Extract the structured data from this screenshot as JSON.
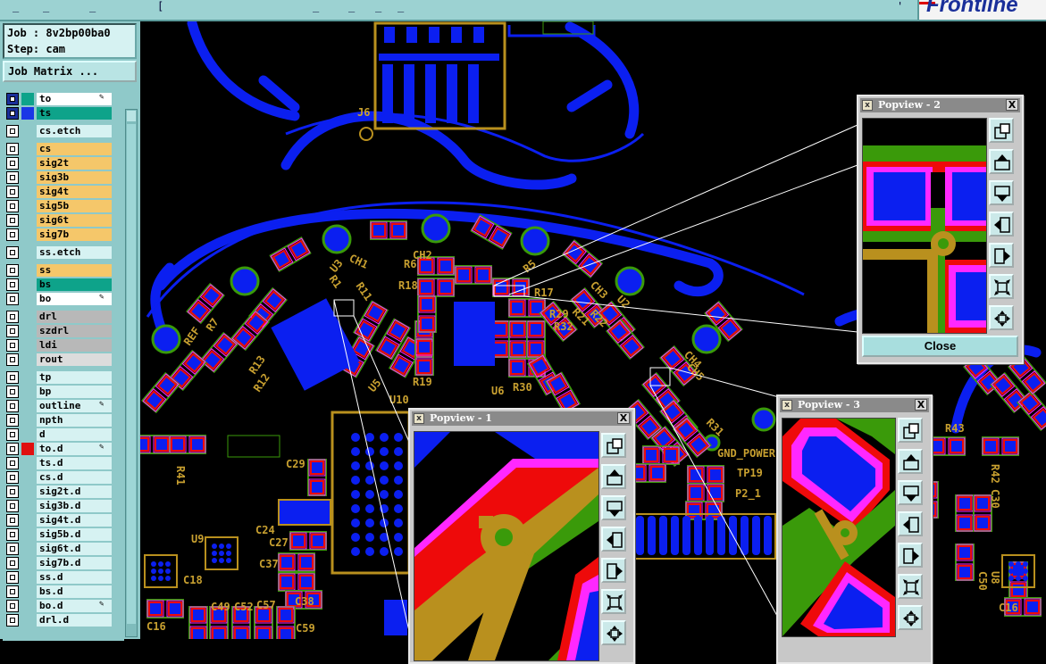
{
  "job": {
    "job_label": "Job : 8v2bp00ba0",
    "step_label": "Step: cam",
    "matrix_button": "Job Matrix ..."
  },
  "colors": {
    "app_bg": "#8fc9c9",
    "yellow_layer": "#f5c76a",
    "green_layer": "#0ea38a",
    "gray_layer": "#b8b8b8",
    "pcb_bg": "#000000",
    "pcb_blue": "#0b1ff0",
    "pcb_gold": "#b9901e",
    "pcb_green": "#3a9a0a",
    "pcb_red": "#ee0a0a",
    "pcb_magenta": "#ff28ff"
  },
  "layers": [
    {
      "name": "to",
      "color": "#ffffff",
      "swatch": "#0ea38a",
      "editable": true,
      "checked": true
    },
    {
      "name": "ts",
      "color": "#0ea38a",
      "swatch": "#1a36e6",
      "editable": false,
      "checked": true
    },
    {
      "name": "cs.etch",
      "color": "#d6f2f2",
      "swatch": "",
      "editable": false,
      "checked": false
    },
    {
      "name": "cs",
      "color": "#f5c76a",
      "swatch": "",
      "editable": false,
      "checked": false
    },
    {
      "name": "sig2t",
      "color": "#f5c76a",
      "swatch": "",
      "editable": false,
      "checked": false
    },
    {
      "name": "sig3b",
      "color": "#f5c76a",
      "swatch": "",
      "editable": false,
      "checked": false
    },
    {
      "name": "sig4t",
      "color": "#f5c76a",
      "swatch": "",
      "editable": false,
      "checked": false
    },
    {
      "name": "sig5b",
      "color": "#f5c76a",
      "swatch": "",
      "editable": false,
      "checked": false
    },
    {
      "name": "sig6t",
      "color": "#f5c76a",
      "swatch": "",
      "editable": false,
      "checked": false
    },
    {
      "name": "sig7b",
      "color": "#f5c76a",
      "swatch": "",
      "editable": false,
      "checked": false
    },
    {
      "name": "ss.etch",
      "color": "#d6f2f2",
      "swatch": "",
      "editable": false,
      "checked": false
    },
    {
      "name": "ss",
      "color": "#f5c76a",
      "swatch": "",
      "editable": false,
      "checked": false
    },
    {
      "name": "bs",
      "color": "#0ea38a",
      "swatch": "",
      "editable": false,
      "checked": false
    },
    {
      "name": "bo",
      "color": "#ffffff",
      "swatch": "",
      "editable": true,
      "checked": false
    },
    {
      "name": "drl",
      "color": "#b8b8b8",
      "swatch": "",
      "editable": false,
      "checked": false
    },
    {
      "name": "szdrl",
      "color": "#b8b8b8",
      "swatch": "",
      "editable": false,
      "checked": false
    },
    {
      "name": "ldi",
      "color": "#b8b8b8",
      "swatch": "",
      "editable": false,
      "checked": false
    },
    {
      "name": "rout",
      "color": "#dcdcdc",
      "swatch": "",
      "editable": false,
      "checked": false
    },
    {
      "name": "tp",
      "color": "#d6f2f2",
      "swatch": "",
      "editable": false,
      "checked": false
    },
    {
      "name": "bp",
      "color": "#d6f2f2",
      "swatch": "",
      "editable": false,
      "checked": false
    },
    {
      "name": "outline",
      "color": "#d6f2f2",
      "swatch": "",
      "editable": true,
      "checked": false
    },
    {
      "name": "npth",
      "color": "#d6f2f2",
      "swatch": "",
      "editable": false,
      "checked": false
    },
    {
      "name": "d",
      "color": "#d6f2f2",
      "swatch": "",
      "editable": false,
      "checked": false
    },
    {
      "name": "to.d",
      "color": "#d6f2f2",
      "swatch": "#e01010",
      "editable": true,
      "checked": false
    },
    {
      "name": "ts.d",
      "color": "#d6f2f2",
      "swatch": "",
      "editable": false,
      "checked": false
    },
    {
      "name": "cs.d",
      "color": "#d6f2f2",
      "swatch": "",
      "editable": false,
      "checked": false
    },
    {
      "name": "sig2t.d",
      "color": "#d6f2f2",
      "swatch": "",
      "editable": false,
      "checked": false
    },
    {
      "name": "sig3b.d",
      "color": "#d6f2f2",
      "swatch": "",
      "editable": false,
      "checked": false
    },
    {
      "name": "sig4t.d",
      "color": "#d6f2f2",
      "swatch": "",
      "editable": false,
      "checked": false
    },
    {
      "name": "sig5b.d",
      "color": "#d6f2f2",
      "swatch": "",
      "editable": false,
      "checked": false
    },
    {
      "name": "sig6t.d",
      "color": "#d6f2f2",
      "swatch": "",
      "editable": false,
      "checked": false
    },
    {
      "name": "sig7b.d",
      "color": "#d6f2f2",
      "swatch": "",
      "editable": false,
      "checked": false
    },
    {
      "name": "ss.d",
      "color": "#d6f2f2",
      "swatch": "",
      "editable": false,
      "checked": false
    },
    {
      "name": "bs.d",
      "color": "#d6f2f2",
      "swatch": "",
      "editable": false,
      "checked": false
    },
    {
      "name": "bo.d",
      "color": "#d6f2f2",
      "swatch": "",
      "editable": true,
      "checked": false
    },
    {
      "name": "drl.d",
      "color": "#d6f2f2",
      "swatch": "",
      "editable": false,
      "checked": false
    }
  ],
  "pcb_labels": [
    "J6",
    "CH1",
    "CH2",
    "U3",
    "R1",
    "R6",
    "R5",
    "R18",
    "R11",
    "R17",
    "CH3",
    "U2",
    "R29",
    "R32",
    "R21",
    "R22",
    "CH4",
    "R7",
    "REF",
    "R13",
    "R12",
    "R19",
    "R30",
    "U5",
    "U6",
    "U10",
    "R31",
    "CH5",
    "R41",
    "R43",
    "R42",
    "C29",
    "C24",
    "C27",
    "C37",
    "C38",
    "C18",
    "U9",
    "C16",
    "C49",
    "C52",
    "C57",
    "C59",
    "TP19",
    "P2_1",
    "GND_POWER",
    "U8",
    "C50",
    "C30",
    "C16"
  ],
  "popups": [
    {
      "title": "Popview - 1",
      "close_label": ""
    },
    {
      "title": "Popview - 2",
      "close_label": "Close"
    },
    {
      "title": "Popview - 3",
      "close_label": ""
    }
  ],
  "popup_buttons": [
    "zoom-home-icon",
    "pan-up-icon",
    "pan-down-icon",
    "pan-left-icon",
    "pan-right-icon",
    "zoom-out-icon",
    "zoom-in-icon"
  ],
  "close_symbol": "X",
  "brand_text": "Frontline"
}
